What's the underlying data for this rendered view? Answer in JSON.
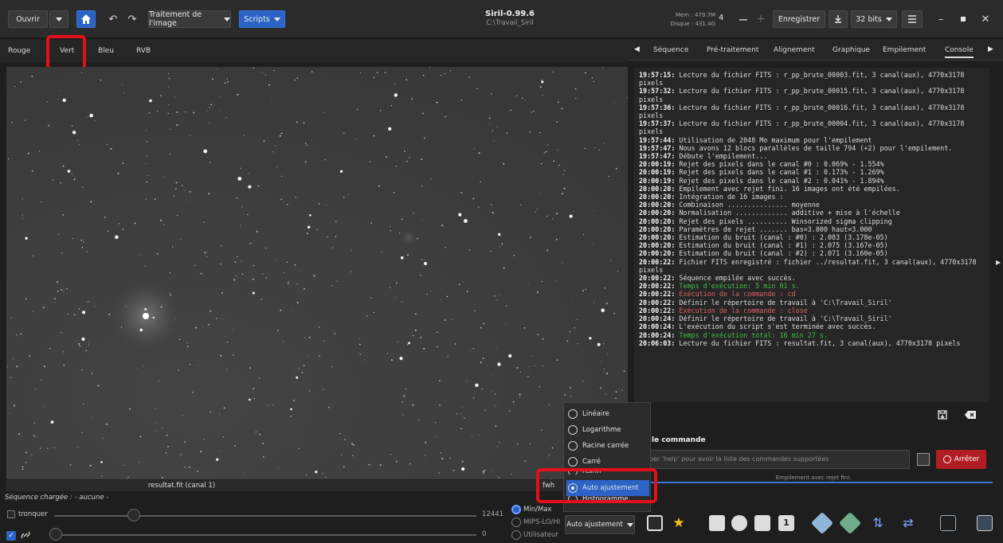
{
  "toolbar": {
    "open_label": "Ouvrir",
    "image_processing_label": "Traitement de l'image",
    "scripts_label": "Scripts",
    "save_label": "Enregistrer",
    "bit_depth_label": "32 bits",
    "threads_value": "4"
  },
  "app": {
    "title": "Siril-0.99.6",
    "path": "C:\\Travail_Siril",
    "mem": "Mem : 479.7M",
    "disk": "Disque : 431.4G"
  },
  "channel_tabs": [
    "Rouge",
    "Vert",
    "Bleu",
    "RVB"
  ],
  "right_tabs": [
    "Séquence",
    "Pré-traitement",
    "Alignement",
    "Graphique",
    "Empilement",
    "Console"
  ],
  "console": {
    "lines": [
      {
        "ts": "19:57:15:",
        "msg": " Lecture du fichier FITS : r_pp_brute_00003.fit, 3 canal(aux), 4770x3178 pixels",
        "style": "normal"
      },
      {
        "ts": "19:57:32:",
        "msg": " Lecture du fichier FITS : r_pp_brute_00015.fit, 3 canal(aux), 4770x3178 pixels",
        "style": "normal"
      },
      {
        "ts": "19:57:36:",
        "msg": " Lecture du fichier FITS : r_pp_brute_00016.fit, 3 canal(aux), 4770x3178 pixels",
        "style": "normal"
      },
      {
        "ts": "19:57:37:",
        "msg": " Lecture du fichier FITS : r_pp_brute_00004.fit, 3 canal(aux), 4770x3178 pixels",
        "style": "normal"
      },
      {
        "ts": "19:57:44:",
        "msg": " Utilisation de 2048 Mo maximum pour l'empilement",
        "style": "normal"
      },
      {
        "ts": "19:57:47:",
        "msg": " Nous avons 12 blocs parallèles de taille 794 (+2) pour l'empilement.",
        "style": "normal"
      },
      {
        "ts": "19:57:47:",
        "msg": " Débute l'empilement...",
        "style": "normal"
      },
      {
        "ts": "20:00:19:",
        "msg": " Rejet des pixels dans le canal #0 : 0.069% - 1.554%",
        "style": "normal"
      },
      {
        "ts": "20:00:19:",
        "msg": " Rejet des pixels dans le canal #1 : 0.173% - 1.269%",
        "style": "normal"
      },
      {
        "ts": "20:00:19:",
        "msg": " Rejet des pixels dans le canal #2 : 0.041% - 1.894%",
        "style": "normal"
      },
      {
        "ts": "20:00:20:",
        "msg": " Empilement avec rejet fini. 16 images ont été empilées.",
        "style": "normal"
      },
      {
        "ts": "20:00:20:",
        "msg": " Intégration de 16 images :",
        "style": "normal"
      },
      {
        "ts": "20:00:20:",
        "msg": " Combinaison ............... moyenne",
        "style": "normal"
      },
      {
        "ts": "20:00:20:",
        "msg": " Normalisation ............. additive + mise à l'échelle",
        "style": "normal"
      },
      {
        "ts": "20:00:20:",
        "msg": " Rejet des pixels .......... Winsorized sigma clipping",
        "style": "normal"
      },
      {
        "ts": "20:00:20:",
        "msg": " Paramètres de rejet ....... bas=3.000 haut=3.000",
        "style": "normal"
      },
      {
        "ts": "20:00:20:",
        "msg": " Estimation du bruit (canal : #0) : 2.083 (3.178e-05)",
        "style": "normal"
      },
      {
        "ts": "20:00:20:",
        "msg": " Estimation du bruit (canal : #1) : 2.075 (3.167e-05)",
        "style": "normal"
      },
      {
        "ts": "20:00:20:",
        "msg": " Estimation du bruit (canal : #2) : 2.071 (3.160e-05)",
        "style": "normal"
      },
      {
        "ts": "20:00:22:",
        "msg": " Fichier FITS enregistré : fichier ../resultat.fit, 3 canal(aux), 4770x3178 pixels",
        "style": "normal"
      },
      {
        "ts": "20:00:22:",
        "msg": " Séquence empilée avec succès.",
        "style": "normal"
      },
      {
        "ts": "20:00:22:",
        "msg": " Temps d'exécution: 5 min 01 s.",
        "style": "green"
      },
      {
        "ts": "20:00:22:",
        "msg": " Exécution de la commande : cd",
        "style": "red"
      },
      {
        "ts": "20:00:22:",
        "msg": " Définir le répertoire de travail à 'C:\\Travail_Siril'",
        "style": "normal"
      },
      {
        "ts": "20:00:22:",
        "msg": " Exécution de la commande : close",
        "style": "red"
      },
      {
        "ts": "20:00:24:",
        "msg": " Définir le répertoire de travail à 'C:\\Travail_Siril'",
        "style": "normal"
      },
      {
        "ts": "20:00:24:",
        "msg": " L'exécution du script s'est terminée avec succès.",
        "style": "normal"
      },
      {
        "ts": "20:00:24:",
        "msg": " Temps d'exécution total: 16 min 27 s.",
        "style": "green"
      },
      {
        "ts": "20:06:03:",
        "msg": " Lecture du fichier FITS : resultat.fit, 3 canal(aux), 4770x3178 pixels",
        "style": "normal"
      }
    ]
  },
  "command_line": {
    "title": "le commande",
    "placeholder": "per 'help' pour avoir la liste des commandes supportées",
    "stop_label": "Arrêter",
    "progress_text": "Empilement avec rejet fini."
  },
  "image": {
    "label": "resultat.fit (canal 1)",
    "fwhm_label": "fwh"
  },
  "sequence_label": "Séquence chargée : - aucune -",
  "bottom": {
    "tronquer_label": "tronquer",
    "high_value": "12441",
    "low_value": "0",
    "radio_minmax": "Min/Max",
    "radio_mips": "MIPS-LO/HI",
    "radio_user": "Utilisateur",
    "display_mode": "Auto ajustement"
  },
  "display_menu": {
    "items": [
      "Linéaire",
      "Logarithme",
      "Racine carrée",
      "Carré",
      "Asinh",
      "Auto ajustement",
      "Histogramme"
    ],
    "selected_index": 5
  },
  "colors": {
    "accent": "#2b63c7",
    "annotation": "#e3101a",
    "stop": "#b01e24"
  }
}
